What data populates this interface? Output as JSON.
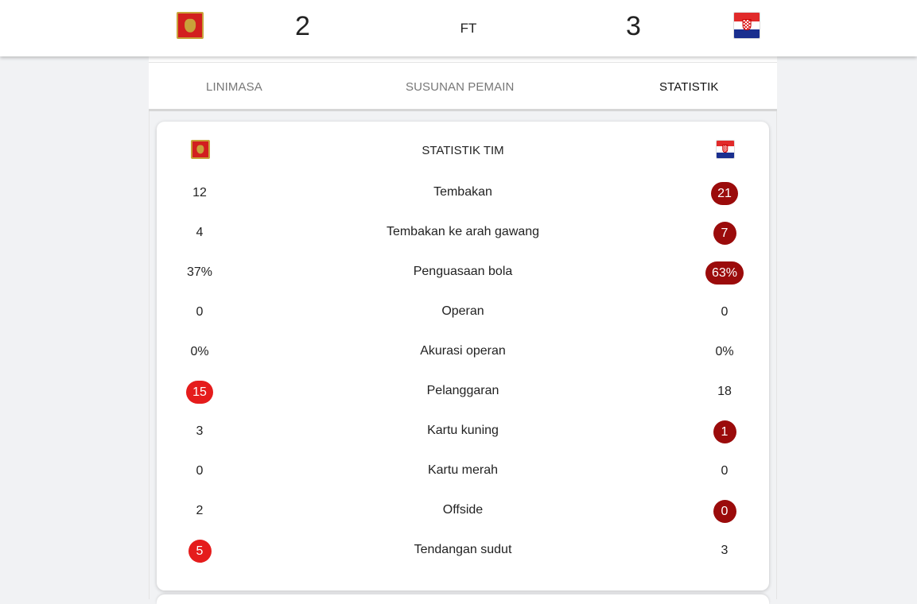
{
  "scoreboard": {
    "home_score": "2",
    "away_score": "3",
    "status": "FT",
    "home_flag_icon": "montenegro-flag-icon",
    "away_flag_icon": "croatia-flag-icon"
  },
  "tabs": [
    {
      "label": "LINIMASA",
      "active": false
    },
    {
      "label": "SUSUNAN PEMAIN",
      "active": false
    },
    {
      "label": "STATISTIK",
      "active": true
    }
  ],
  "stats": {
    "title": "STATISTIK TIM",
    "rows": [
      {
        "label": "Tembakan",
        "home": "12",
        "away": "21",
        "highlight": "away",
        "highlight_color": "dark"
      },
      {
        "label": "Tembakan ke arah gawang",
        "home": "4",
        "away": "7",
        "highlight": "away",
        "highlight_color": "dark"
      },
      {
        "label": "Penguasaan bola",
        "home": "37%",
        "away": "63%",
        "highlight": "away",
        "highlight_color": "dark"
      },
      {
        "label": "Operan",
        "home": "0",
        "away": "0",
        "highlight": "none"
      },
      {
        "label": "Akurasi operan",
        "home": "0%",
        "away": "0%",
        "highlight": "none"
      },
      {
        "label": "Pelanggaran",
        "home": "15",
        "away": "18",
        "highlight": "home",
        "highlight_color": "red"
      },
      {
        "label": "Kartu kuning",
        "home": "3",
        "away": "1",
        "highlight": "away",
        "highlight_color": "dark"
      },
      {
        "label": "Kartu merah",
        "home": "0",
        "away": "0",
        "highlight": "none"
      },
      {
        "label": "Offside",
        "home": "2",
        "away": "0",
        "highlight": "away",
        "highlight_color": "dark"
      },
      {
        "label": "Tendangan sudut",
        "home": "5",
        "away": "3",
        "highlight": "home",
        "highlight_color": "red"
      }
    ]
  },
  "colors": {
    "highlight_red": "#e51c1c",
    "highlight_dark_red": "#9b0b0b",
    "page_background": "#f1f2f4"
  }
}
